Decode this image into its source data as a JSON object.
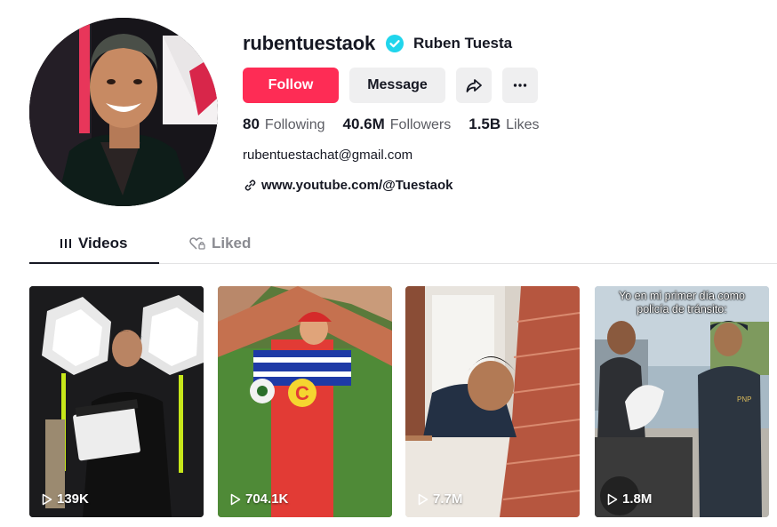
{
  "profile": {
    "username": "rubentuestaok",
    "nickname": "Ruben Tuesta",
    "verified": true,
    "bio_email": "rubentuestachat@gmail.com",
    "link": "www.youtube.com/@Tuestaok"
  },
  "actions": {
    "follow_label": "Follow",
    "message_label": "Message",
    "share_icon": "share-icon",
    "more_icon": "more-icon"
  },
  "stats": {
    "following_count": "80",
    "following_label": "Following",
    "followers_count": "40.6M",
    "followers_label": "Followers",
    "likes_count": "1.5B",
    "likes_label": "Likes"
  },
  "tabs": [
    {
      "label": "Videos",
      "icon": "grid-icon",
      "active": true
    },
    {
      "label": "Liked",
      "icon": "heart-lock-icon",
      "active": false
    }
  ],
  "videos": [
    {
      "views": "139K",
      "caption": ""
    },
    {
      "views": "704.1K",
      "caption": ""
    },
    {
      "views": "7.7M",
      "caption": ""
    },
    {
      "views": "1.8M",
      "caption_line1": "Yo en mi primer día como",
      "caption_line2": "policía de tránsito:"
    }
  ],
  "colors": {
    "accent": "#fe2c55",
    "verified": "#20d5ec",
    "text_primary": "#161823",
    "text_secondary": "#5b5c63",
    "button_secondary": "#efeff0"
  }
}
